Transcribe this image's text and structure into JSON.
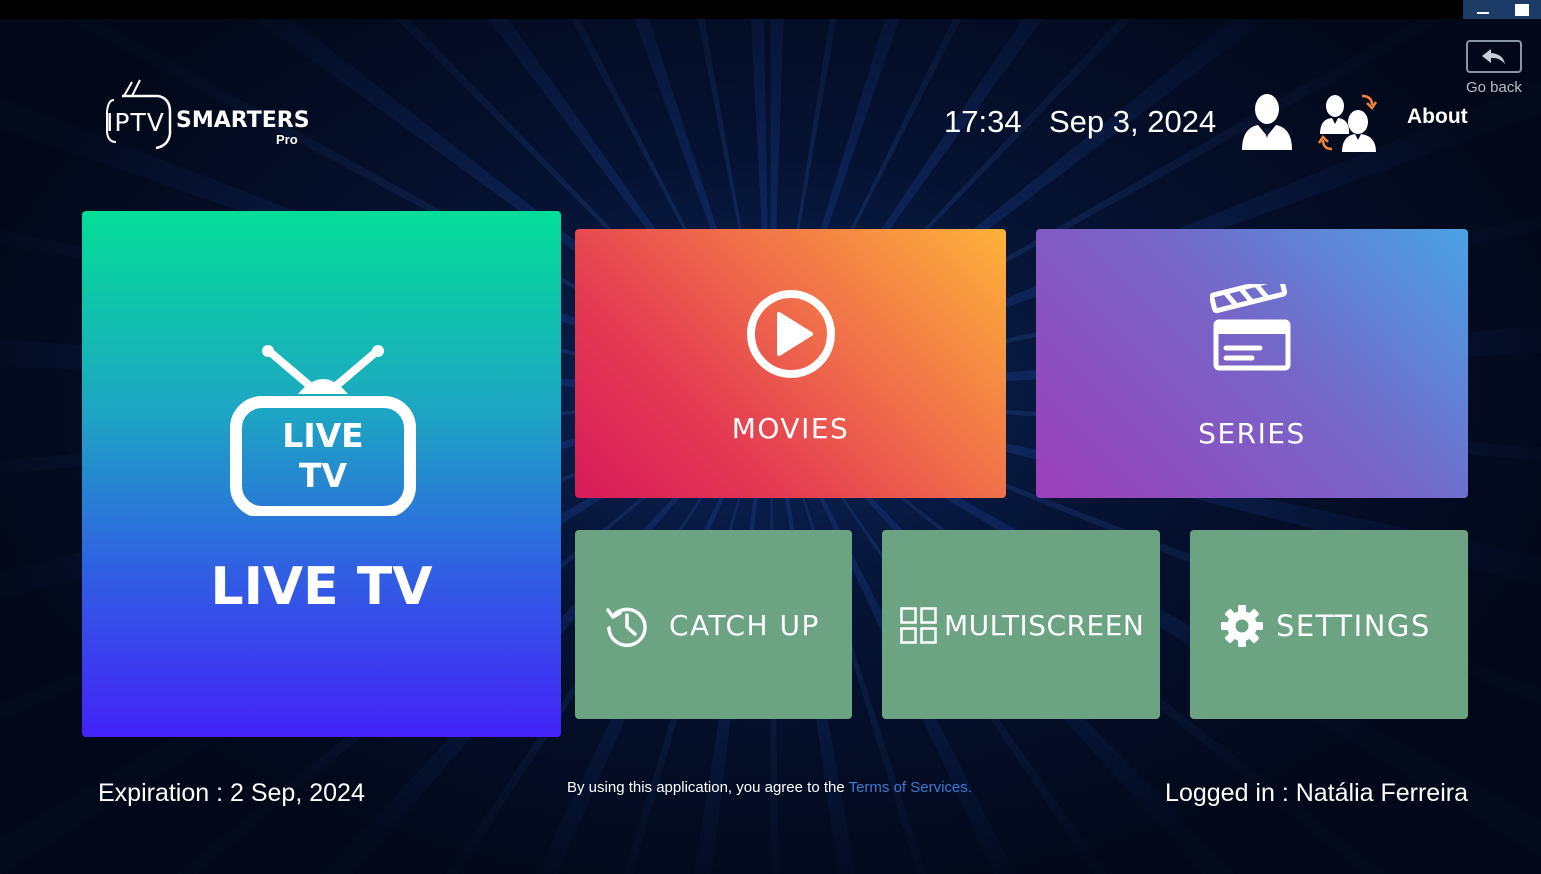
{
  "header": {
    "logo_iptv": "IPTV",
    "logo_smarters": "SMARTERS",
    "logo_pro": "Pro",
    "time": "17:34",
    "date": "Sep 3, 2024",
    "about_label": "About",
    "go_back_label": "Go back"
  },
  "tiles": {
    "live_tv": {
      "label": "LIVE TV",
      "icon_line1": "LIVE",
      "icon_line2": "TV"
    },
    "movies": {
      "label": "MOVIES"
    },
    "series": {
      "label": "SERIES"
    },
    "catch_up": {
      "label": "CATCH UP"
    },
    "multiscreen": {
      "label": "MULTISCREEN"
    },
    "settings": {
      "label": "SETTINGS"
    }
  },
  "footer": {
    "expiration": "Expiration : 2 Sep, 2024",
    "terms_prefix": "By using this application, you agree to the ",
    "terms_link": "Terms of Services.",
    "logged_in": "Logged in : Natália Ferreira"
  },
  "icons": {
    "profile": "user-icon",
    "switch_user": "switch-users-icon",
    "go_back": "reply-arrow-icon",
    "live_tv": "tv-antenna-icon",
    "movies": "play-circle-icon",
    "series": "clapperboard-icon",
    "catch_up": "clock-history-icon",
    "multiscreen": "grid-icon",
    "settings": "gear-icon"
  },
  "colors": {
    "background": "#020b1e",
    "live_tv_top": "#04de97",
    "live_tv_bottom": "#4422f8",
    "movies_start": "#fdb23a",
    "movies_end": "#d81a5b",
    "series_start": "#4aa3e4",
    "series_end": "#9c3fb8",
    "small_tiles": "#6ca382",
    "terms_link": "#3f79d2"
  }
}
